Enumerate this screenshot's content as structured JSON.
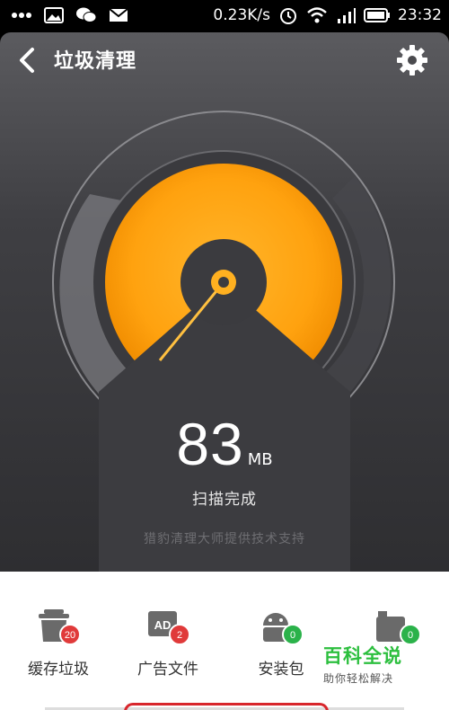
{
  "status_bar": {
    "speed": "0.23K/s",
    "time": "23:32"
  },
  "header": {
    "title": "垃圾清理"
  },
  "gauge": {
    "size_value": "83",
    "size_unit": "MB",
    "status_text": "扫描完成",
    "powered_by": "猎豹清理大师提供技术支持"
  },
  "categories": [
    {
      "label": "缓存垃圾",
      "badge": "20",
      "icon": "trash-can-icon"
    },
    {
      "label": "广告文件",
      "badge": "2",
      "icon": "ad-icon"
    },
    {
      "label": "安装包",
      "badge": "0",
      "icon": "android-icon"
    },
    {
      "label": "",
      "badge": "0",
      "icon": "residual-icon"
    }
  ],
  "watermark": {
    "title": "百科全说",
    "subtitle": "助你轻松解决"
  },
  "colors": {
    "accent": "#ffa500",
    "badge_red": "#e03a3a",
    "badge_green": "#2bb24a"
  }
}
